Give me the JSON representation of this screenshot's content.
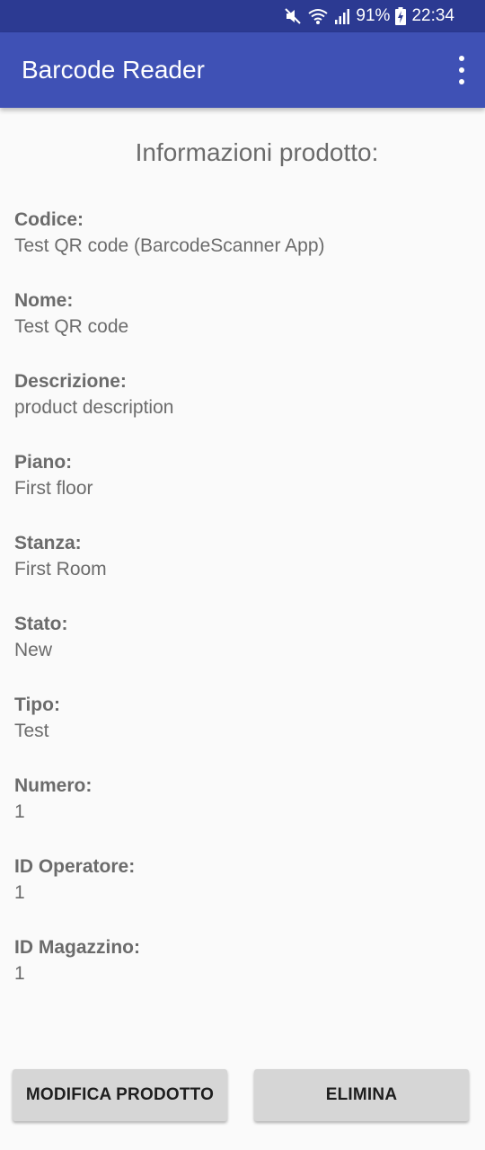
{
  "status_bar": {
    "battery": "91%",
    "time": "22:34",
    "icons": [
      "mute-icon",
      "wifi-icon",
      "signal-icon",
      "battery-charging-icon"
    ]
  },
  "app_bar": {
    "title": "Barcode Reader",
    "menu_icon": "overflow-menu-icon"
  },
  "page": {
    "title": "Informazioni prodotto:"
  },
  "fields": [
    {
      "label": "Codice:",
      "value": "Test QR code (BarcodeScanner App)"
    },
    {
      "label": "Nome:",
      "value": "Test QR code"
    },
    {
      "label": "Descrizione:",
      "value": "product description"
    },
    {
      "label": "Piano:",
      "value": "First floor"
    },
    {
      "label": "Stanza:",
      "value": "First Room"
    },
    {
      "label": "Stato:",
      "value": "New"
    },
    {
      "label": "Tipo:",
      "value": "Test"
    },
    {
      "label": "Numero:",
      "value": "1"
    },
    {
      "label": "ID Operatore:",
      "value": "1"
    },
    {
      "label": "ID Magazzino:",
      "value": "1"
    }
  ],
  "actions": {
    "edit_label": "MODIFICA PRODOTTO",
    "delete_label": "ELIMINA"
  },
  "colors": {
    "primary": "#3f51b5",
    "primary_dark": "#2c3a92",
    "background": "#fafafa",
    "button": "#d6d6d6"
  }
}
